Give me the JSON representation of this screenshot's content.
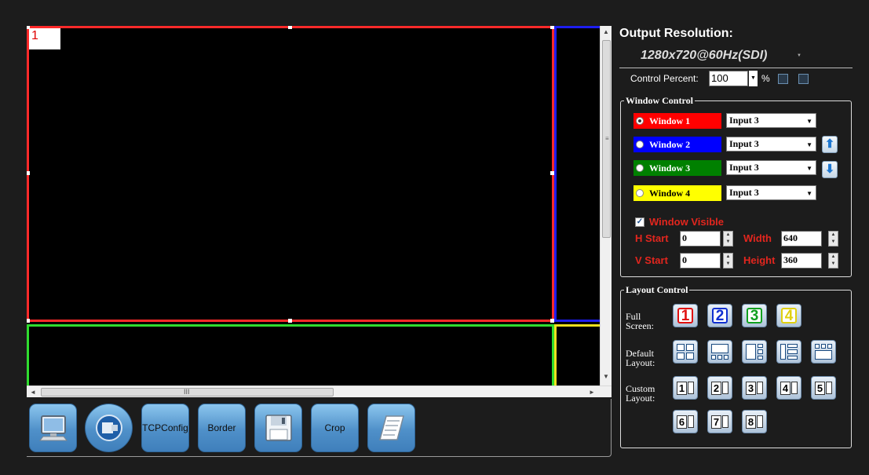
{
  "canvas": {
    "windows": [
      {
        "number": "1",
        "color": "#ff2a2a"
      },
      {
        "color": "#1e1ef0"
      },
      {
        "color": "#2fdc2f"
      },
      {
        "color": "#f0e020"
      }
    ]
  },
  "scrollbar": {
    "vgrip": "≡",
    "hgrip": "III",
    "up": "▲",
    "down": "▼",
    "left": "◄",
    "right": "►"
  },
  "toolbar": {
    "buttons": [
      {
        "icon": "computer-icon",
        "label": ""
      },
      {
        "icon": "input-device-icon",
        "label": ""
      },
      {
        "icon": "",
        "label": "TCPConfig"
      },
      {
        "icon": "",
        "label": "Border"
      },
      {
        "icon": "floppy-disk-icon",
        "label": ""
      },
      {
        "icon": "",
        "label": "Crop"
      },
      {
        "icon": "document-icon",
        "label": ""
      }
    ]
  },
  "output": {
    "title": "Output Resolution:",
    "resolution": "1280x720@60Hz(SDI)"
  },
  "control_percent": {
    "label": "Control Percent:",
    "value": "100",
    "unit": "%"
  },
  "window_control": {
    "title": "Window Control",
    "windows": [
      {
        "label": "Window 1",
        "color": "#ff0000",
        "text_color": "#ffffff",
        "selected": true,
        "input": "Input 3"
      },
      {
        "label": "Window 2",
        "color": "#0000ff",
        "text_color": "#ffffff",
        "selected": false,
        "input": "Input 3"
      },
      {
        "label": "Window 3",
        "color": "#008000",
        "text_color": "#ffffff",
        "selected": false,
        "input": "Input 3"
      },
      {
        "label": "Window 4",
        "color": "#ffff00",
        "text_color": "#000000",
        "selected": false,
        "input": "Input 3"
      }
    ],
    "visible_label": "Window Visible",
    "visible_checked": true,
    "h_start_label": "H Start",
    "h_start": "0",
    "v_start_label": "V Start",
    "v_start": "0",
    "width_label": "Width",
    "width": "640",
    "height_label": "Height",
    "height": "360"
  },
  "layout_control": {
    "title": "Layout Control",
    "full_screen_label": "Full Screen:",
    "default_layout_label": "Default Layout:",
    "custom_layout_label": "Custom Layout:",
    "full_screen": [
      {
        "n": "1",
        "color": "#e01010"
      },
      {
        "n": "2",
        "color": "#1030d0"
      },
      {
        "n": "3",
        "color": "#10a020"
      },
      {
        "n": "4",
        "color": "#e0d010"
      }
    ],
    "custom": [
      "1",
      "2",
      "3",
      "4",
      "5",
      "6",
      "7",
      "8"
    ]
  }
}
